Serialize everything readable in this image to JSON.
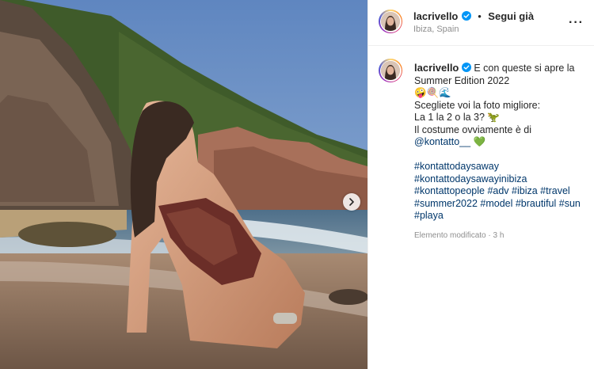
{
  "post": {
    "username": "lacrivello",
    "follow_label": "Segui già",
    "separator": "•",
    "location": "Ibiza, Spain",
    "more_label": "···"
  },
  "caption": {
    "username": "lacrivello",
    "line1": "E con queste si apre la",
    "line2": "Summer Edition 2022",
    "line3": "🤪🍭🌊",
    "line4": "Scegliete voi la foto migliore:",
    "line5": "La 1 la 2 o la 3? 🦖",
    "line6": "Il costume ovviamente è di",
    "mention": "@kontatto__",
    "mention_emoji": "💚",
    "tags": [
      "#kontattodaysaway",
      "#kontattodaysawayinibiza",
      "#kontattopeople #adv #ibiza #travel",
      "#summer2022 #model #brautiful #sun",
      "#playa"
    ]
  },
  "meta": {
    "edited": "Elemento modificato · 3 h"
  },
  "colors": {
    "link": "#00376b",
    "verified": "#0095f6",
    "muted": "#8e8e8e"
  },
  "icons": {
    "next": "chevron-right-icon",
    "verified": "verified-badge-icon",
    "more": "more-options-icon"
  }
}
